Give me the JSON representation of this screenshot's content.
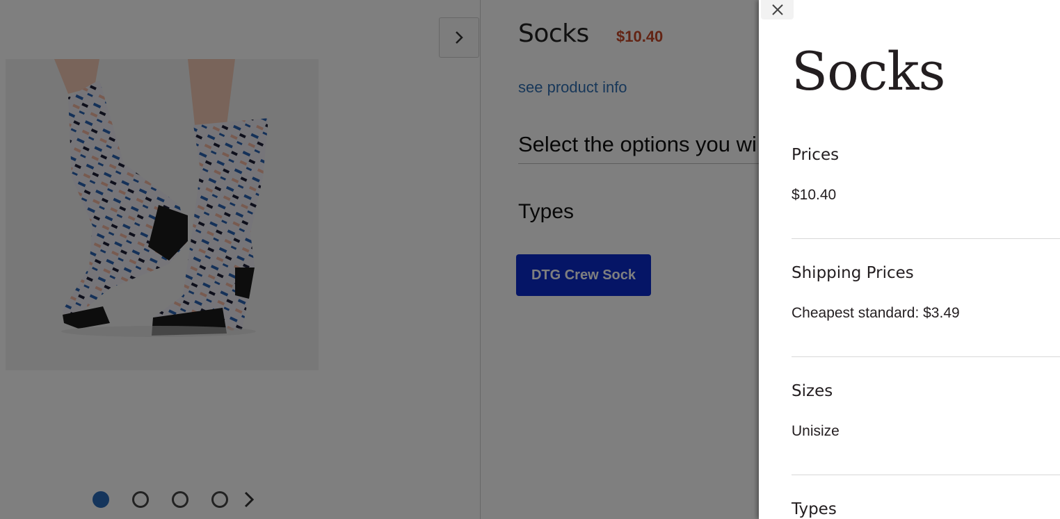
{
  "product": {
    "title": "Socks",
    "price": "$10.40",
    "info_link": "see product info",
    "select_label": "Select the options you wi",
    "types_heading": "Types",
    "type_option": "DTG Crew Sock"
  },
  "carousel": {
    "dot_count": 4,
    "active_index": 0
  },
  "info_panel": {
    "title": "Socks",
    "sections": [
      {
        "heading": "Prices",
        "value": "$10.40"
      },
      {
        "heading": "Shipping Prices",
        "value": "Cheapest standard: $3.49"
      },
      {
        "heading": "Sizes",
        "value": "Unisize"
      },
      {
        "heading": "Types",
        "value": ""
      }
    ]
  },
  "icons": {
    "close": "close-icon",
    "next": "chevron-right-icon",
    "carousel_next": "chevron-right-icon"
  },
  "colors": {
    "price": "#c64828",
    "link": "#2f6fb3",
    "type_button": "#0a2bcc",
    "dot_active": "#2a6bb8"
  }
}
